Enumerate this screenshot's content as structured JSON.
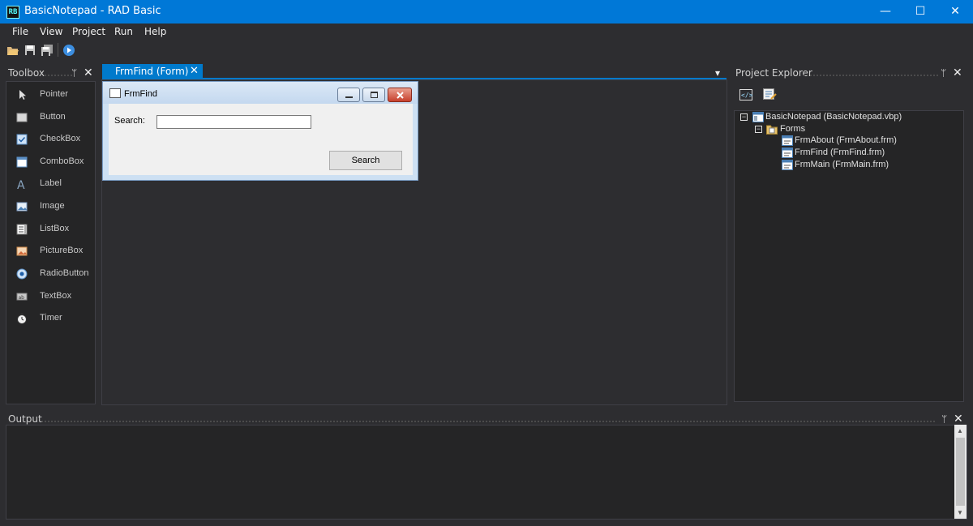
{
  "window": {
    "icon_text": "RB",
    "title": "BasicNotepad - RAD Basic",
    "minimize": "—",
    "maximize": "☐",
    "close": "✕"
  },
  "menu": [
    "File",
    "View",
    "Project",
    "Run",
    "Help"
  ],
  "toolbar": {
    "open": "open-folder-icon",
    "save": "save-icon",
    "save_all": "save-all-icon",
    "run": "run-icon"
  },
  "toolbox": {
    "title": "Toolbox",
    "pin": "ᛘ",
    "close": "✕",
    "items": [
      {
        "label": "Pointer",
        "icon": "pointer-icon"
      },
      {
        "label": "Button",
        "icon": "button-icon"
      },
      {
        "label": "CheckBox",
        "icon": "checkbox-icon"
      },
      {
        "label": "ComboBox",
        "icon": "combobox-icon"
      },
      {
        "label": "Label",
        "icon": "label-icon"
      },
      {
        "label": "Image",
        "icon": "image-icon"
      },
      {
        "label": "ListBox",
        "icon": "listbox-icon"
      },
      {
        "label": "PictureBox",
        "icon": "picturebox-icon"
      },
      {
        "label": "RadioButton",
        "icon": "radiobutton-icon"
      },
      {
        "label": "TextBox",
        "icon": "textbox-icon"
      },
      {
        "label": "Timer",
        "icon": "timer-icon"
      }
    ]
  },
  "document": {
    "tab_label": "FrmFind (Form)",
    "tab_close": "✕",
    "dropdown": "▾"
  },
  "form": {
    "caption": "FrmFind",
    "search_label": "Search:",
    "search_value": "",
    "search_button": "Search"
  },
  "project_explorer": {
    "title": "Project Explorer",
    "pin": "ᛘ",
    "close": "✕",
    "tree": {
      "project": "BasicNotepad (BasicNotepad.vbp)",
      "folder": "Forms",
      "forms": [
        "FrmAbout (FrmAbout.frm)",
        "FrmFind (FrmFind.frm)",
        "FrmMain (FrmMain.frm)"
      ]
    }
  },
  "output": {
    "title": "Output",
    "pin": "ᛘ",
    "close": "✕",
    "scroll_up": "▲",
    "scroll_down": "▼"
  },
  "colors": {
    "accent": "#007acc",
    "titlebar": "#0078d7",
    "background": "#2d2d30",
    "panel": "#252526"
  }
}
